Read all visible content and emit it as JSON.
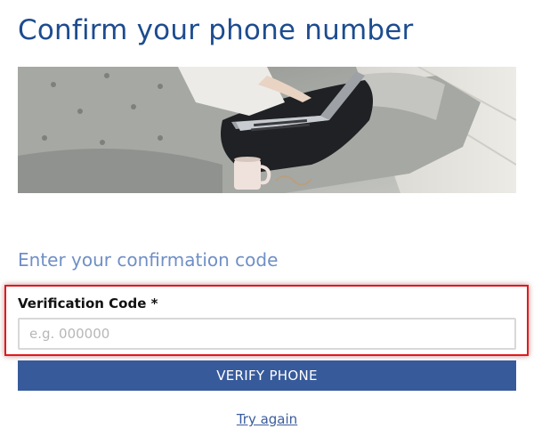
{
  "page": {
    "title": "Confirm your phone number",
    "subtitle": "Enter your confirmation code"
  },
  "hero": {
    "description_icon": "person-with-laptop-on-sofa-photo"
  },
  "form": {
    "label": "Verification Code *",
    "placeholder": "e.g. 000000",
    "value": "",
    "submit_label": "VERIFY PHONE",
    "retry_label": "Try again"
  },
  "colors": {
    "title": "#1d4c8f",
    "subtitle": "#6f8fc6",
    "button": "#375a9b",
    "highlight": "#e3191b"
  }
}
